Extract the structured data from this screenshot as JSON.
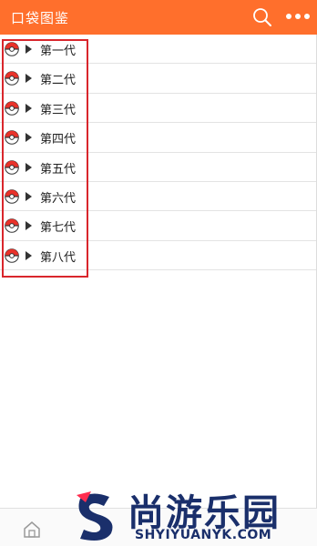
{
  "header": {
    "title": "口袋图鉴",
    "background": "#ff6f2c",
    "icons": [
      "search-icon",
      "more-icon"
    ]
  },
  "generations": [
    {
      "label": "第一代"
    },
    {
      "label": "第二代"
    },
    {
      "label": "第三代"
    },
    {
      "label": "第四代"
    },
    {
      "label": "第五代"
    },
    {
      "label": "第六代"
    },
    {
      "label": "第七代"
    },
    {
      "label": "第八代"
    }
  ],
  "highlight_color": "#d9262c",
  "watermark": {
    "title": "尚游乐园",
    "url": "SHYIYUANYK.COM"
  }
}
